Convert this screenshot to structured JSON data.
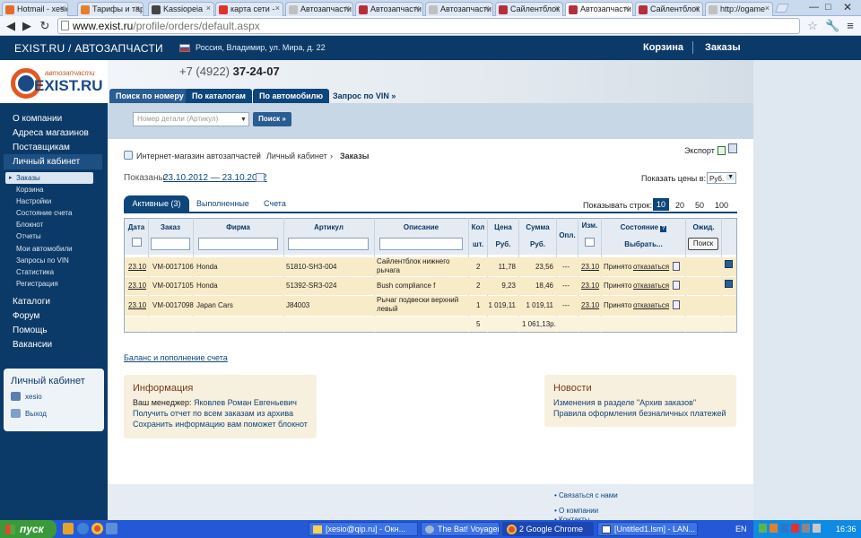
{
  "browser": {
    "tabs": [
      {
        "label": "Hotmail - xesio",
        "color": "#e46b2c"
      },
      {
        "label": "Тарифы и тар",
        "color": "#e57f2b"
      },
      {
        "label": "Kassiopeia",
        "color": "#444"
      },
      {
        "label": "карта сети -",
        "color": "#e0322d"
      },
      {
        "label": "Автозапчасти",
        "color": "#c0c0c0"
      },
      {
        "label": "Автозапчасти",
        "color": "#b42f3b"
      },
      {
        "label": "Автозапчасти",
        "color": "#c0c0c0"
      },
      {
        "label": "Сайлентблок",
        "color": "#b42f3b"
      },
      {
        "label": "Автозапчасти",
        "color": "#b42f3b"
      },
      {
        "label": "Сайлентблок",
        "color": "#b42f3b"
      },
      {
        "label": "http://ogame",
        "color": "#c0c0c0"
      }
    ],
    "url_host": "www.exist.ru",
    "url_path": "/profile/orders/default.aspx"
  },
  "site": {
    "brand": "EXIST.RU / АВТОЗАПЧАСТИ",
    "location": "Россия, Владимир, ул. Мира, д. 22",
    "cart": "Корзина",
    "orders": "Заказы",
    "phone_code": "+7 (4922)",
    "phone_number": "37-24-07",
    "logo_small": "автозапчасти",
    "logo_big": "EXIST.RU"
  },
  "search_tabs": [
    "Поиск по номеру",
    "По каталогам",
    "По автомобилю",
    "Запрос по VIN »"
  ],
  "search": {
    "placeholder": "Номер детали (Артикул)",
    "button": "Поиск »"
  },
  "sidebar": {
    "top": [
      "О компании",
      "Адреса магазинов",
      "Поставщикам",
      "Личный кабинет"
    ],
    "sub": [
      "Заказы",
      "Корзина",
      "Настройки",
      "Состояние счета",
      "Блокнот",
      "Отчеты",
      "Мои автомобили",
      "Запросы по VIN",
      "Статистика",
      "Регистрация"
    ],
    "bottom": [
      "Каталоги",
      "Форум",
      "Помощь",
      "Вакансии"
    ],
    "box_title": "Личный кабинет",
    "user": "xesio",
    "logout": "Выход"
  },
  "breadcrumb": {
    "a": "Интернет-магазин автозапчастей",
    "b": "Личный кабинет",
    "c": "Заказы"
  },
  "export": "Экспорт",
  "shown_label": "Показаны:",
  "date_range": "23.10.2012 — 23.10.2012",
  "prices_label": "Показать цены в:",
  "currency": "Руб.",
  "order_tabs": [
    "Активные (3)",
    "Выполненные",
    "Счета"
  ],
  "rows_label": "Показывать строк:",
  "rows_options": [
    "10",
    "20",
    "50",
    "100"
  ],
  "table": {
    "headers": [
      "Дата",
      "Заказ",
      "Фирма",
      "Артикул",
      "Описание",
      "Кол",
      "Цена",
      "Сумма",
      "Опл.",
      "Изм.",
      "Состояние",
      "Ожид."
    ],
    "sub_headers": {
      "qty": "шт.",
      "price": "Руб.",
      "sum": "Руб.",
      "status": "Выбрать...",
      "search": "Поиск"
    },
    "rows": [
      {
        "date": "23.10",
        "order": "VM-0017106",
        "firm": "Honda",
        "article": "51810-SH3-004",
        "desc": "Сайлентблок нижнего рычага",
        "qty": "2",
        "price": "11,78",
        "sum": "23,56",
        "paid": "---",
        "changed": "23.10",
        "status": "Принято",
        "cancel": "отказаться"
      },
      {
        "date": "23.10",
        "order": "VM-0017105",
        "firm": "Honda",
        "article": "51392-SR3-024",
        "desc": "Bush compliance f",
        "qty": "2",
        "price": "9,23",
        "sum": "18,46",
        "paid": "---",
        "changed": "23.10",
        "status": "Принято",
        "cancel": "отказаться"
      },
      {
        "date": "23.10",
        "order": "VM-0017098",
        "firm": "Japan Cars",
        "article": "J84003",
        "desc": "Рычаг подвески верхний левый",
        "qty": "1",
        "price": "1 019,11",
        "sum": "1 019,11",
        "paid": "---",
        "changed": "23.10",
        "status": "Принято",
        "cancel": "отказаться"
      }
    ],
    "total_qty": "5",
    "total_sum": "1 061,13р."
  },
  "balance_link": "Баланс и пополнение счета",
  "info": {
    "title": "Информация",
    "manager_label": "Ваш менеджер:",
    "manager": "Яковлев Роман Евгеньевич",
    "l2": "Получить отчет по всем заказам из архива",
    "l3": "Сохранить информацию вам поможет блокнот"
  },
  "news": {
    "title": "Новости",
    "l1": "Изменения в разделе \"Архив заказов\"",
    "l2": "Правила оформления безналичных платежей"
  },
  "footer": {
    "contact": "Связаться с нами",
    "about": "О компании",
    "contacts": "Контакты"
  },
  "taskbar": {
    "start": "пуск",
    "tasks": [
      "[xesio@qip.ru] - Окн...",
      "The Bat! Voyager",
      "2 Google Chrome",
      "[Untitled1.lsm] - LAN..."
    ],
    "lang": "EN",
    "time": "16:36"
  }
}
